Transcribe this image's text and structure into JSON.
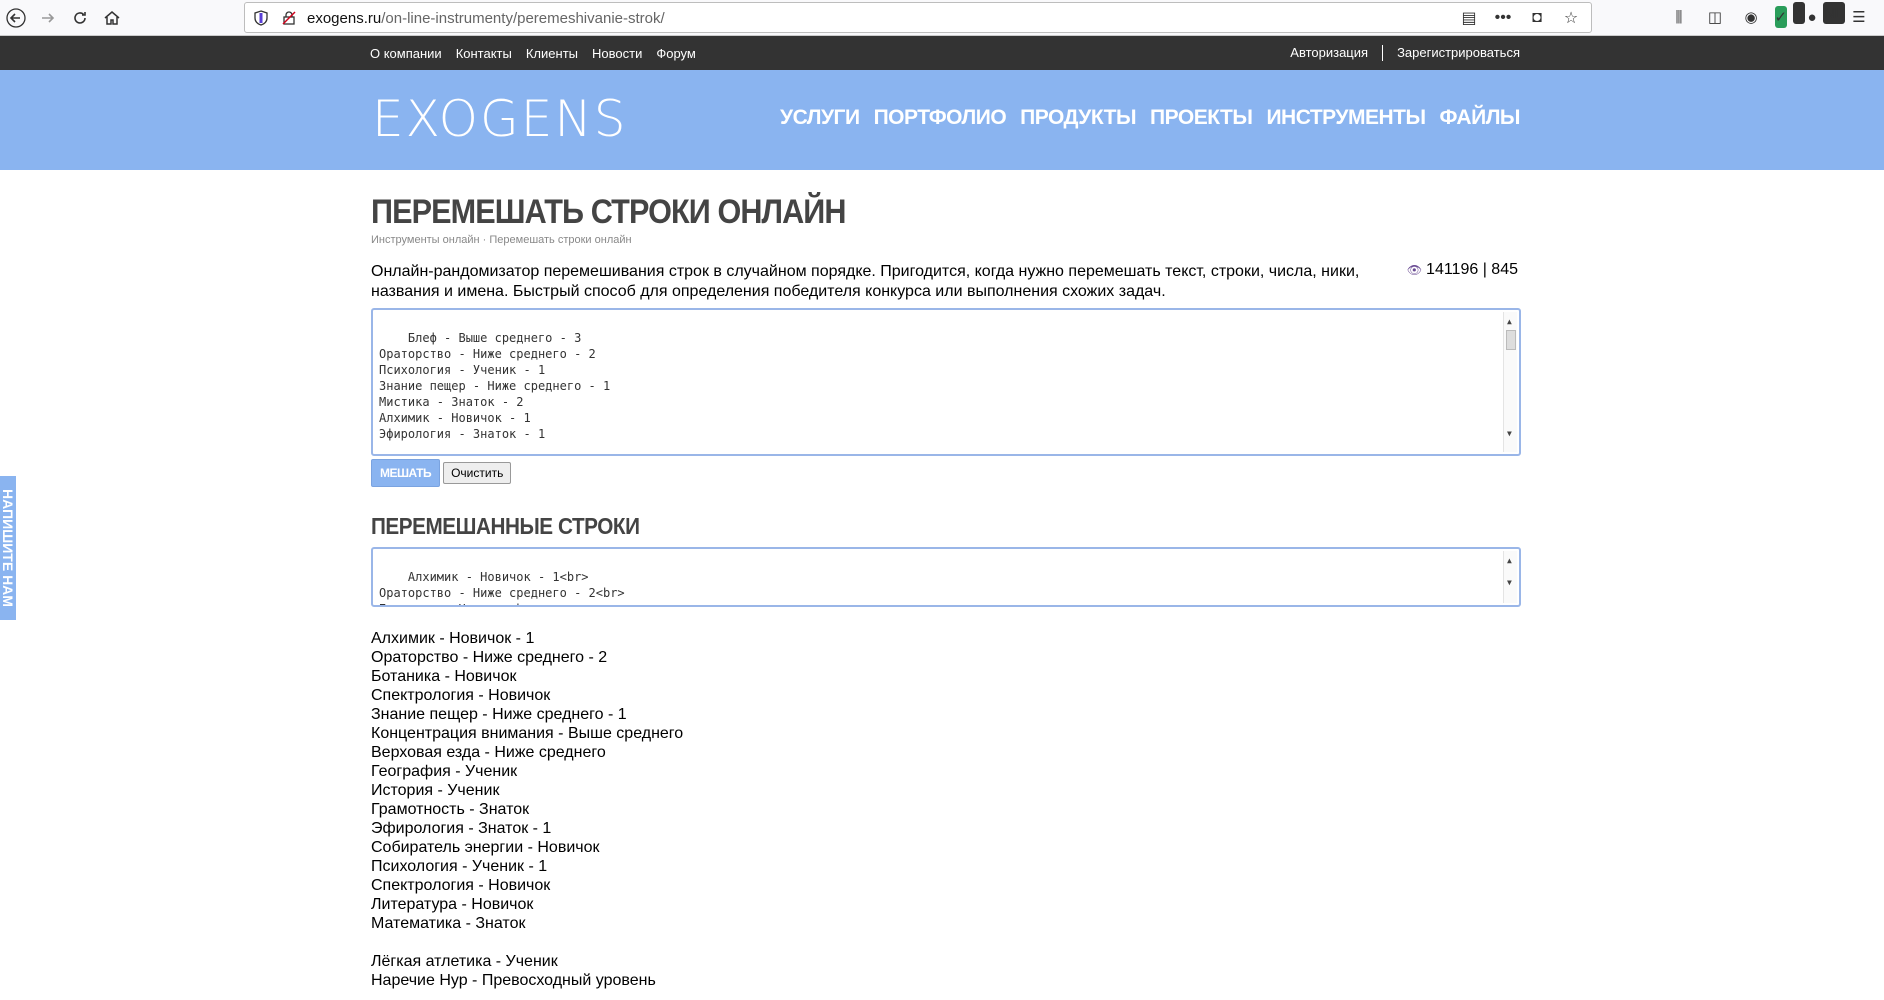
{
  "browser": {
    "url_domain": "exogens.ru",
    "url_path": "/on-line-instrumenty/peremeshivanie-strok/",
    "badge_count": "4",
    "profile_badge": "NL"
  },
  "top_nav": {
    "links": [
      "О компании",
      "Контакты",
      "Клиенты",
      "Новости",
      "Форум"
    ],
    "login": "Авторизация",
    "register": "Зарегистрироваться"
  },
  "header": {
    "logo": "EXOGENS",
    "menu": [
      "УСЛУГИ",
      "ПОРТФОЛИО",
      "ПРОДУКТЫ",
      "ПРОЕКТЫ",
      "ИНСТРУМЕНТЫ",
      "ФАЙЛЫ"
    ]
  },
  "page": {
    "title": "ПЕРЕМЕШАТЬ СТРОКИ ОНЛАЙН",
    "breadcrumb_parent": "Инструменты онлайн",
    "breadcrumb_sep": " · ",
    "breadcrumb_current": "Перемешать строки онлайн",
    "intro": "Онлайн-рандомизатор перемешивания строк в случайном порядке. Пригодится, когда нужно перемешать текст, строки, числа, ники, названия и имена. Быстрый способ для определения победителя конкурса или выполнения схожих задач.",
    "views": "141196 | 845",
    "input_text": "Блеф - Выше среднего - 3\nОраторство - Ниже среднего - 2\nПсихология - Ученик - 1\nЗнание пещер - Ниже среднего - 1\nМистика - Знаток - 2\nАлхимик - Новичок - 1\nЭфирология - Знаток - 1\n\nНаречие Нур - Превосходный уровень",
    "mix_button": "МЕШАТЬ",
    "clear_button": "Очистить",
    "result_title": "ПЕРЕМЕШАННЫЕ СТРОКИ",
    "result_text": "Алхимик - Новичок - 1<br>\nОраторство - Ниже среднего - 2<br>\nБотаника - Новичок<br>"
  },
  "results": [
    "Алхимик - Новичок - 1",
    "Ораторство - Ниже среднего - 2",
    "Ботаника - Новичок",
    "Спектрология - Новичок",
    "Знание пещер - Ниже среднего - 1",
    "Концентрация внимания - Выше среднего",
    "Верховая езда - Ниже среднего",
    "География - Ученик",
    "История - Ученик",
    "Грамотность - Знаток",
    "Эфирология - Знаток - 1",
    "Собиратель энергии - Новичок",
    "Психология - Ученик - 1",
    "Спектрология - Новичок",
    "Литература - Новичок",
    "Математика - Знаток",
    "",
    "Лёгкая атлетика - Ученик",
    "Наречие Нур - Превосходный уровень"
  ],
  "feedback_tab": "НАПИШИТЕ НАМ"
}
